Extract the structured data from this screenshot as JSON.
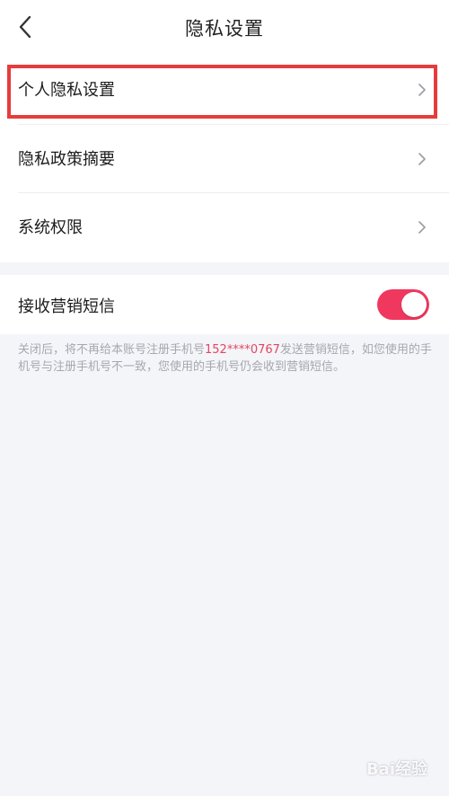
{
  "header": {
    "title": "隐私设置",
    "back_icon": "chevron-left-icon"
  },
  "menu": {
    "items": [
      {
        "label": "个人隐私设置",
        "icon": "chevron-right-icon"
      },
      {
        "label": "隐私政策摘要",
        "icon": "chevron-right-icon"
      },
      {
        "label": "系统权限",
        "icon": "chevron-right-icon"
      }
    ]
  },
  "marketing": {
    "label": "接收营销短信",
    "enabled": true,
    "toggle_color": "#f0385f",
    "note_before": "关闭后，将不再给本账号注册手机号",
    "phone": "152****0767",
    "note_after": "发送营销短信，如您使用的手机号与注册手机号不一致，您使用的手机号仍会收到营销短信。"
  },
  "highlight_color": "#e63c3c",
  "watermark": "Bai经验"
}
